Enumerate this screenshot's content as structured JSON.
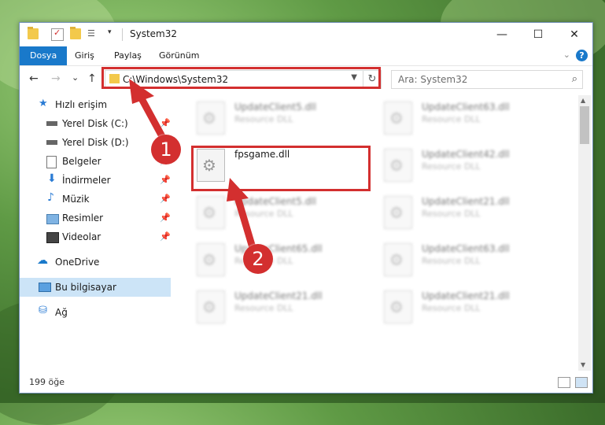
{
  "window": {
    "title": "System32",
    "tabs": [
      {
        "label": "Dosya"
      },
      {
        "label": "Giriş"
      },
      {
        "label": "Paylaş"
      },
      {
        "label": "Görünüm"
      }
    ],
    "controls": {
      "minimize": "—",
      "maximize": "☐",
      "close": "✕"
    }
  },
  "nav": {
    "back": "←",
    "forward": "→",
    "recent": "⌄",
    "up": "↑",
    "address": "C:\\Windows\\System32",
    "refresh": "↻",
    "search_placeholder": "Ara: System32"
  },
  "sidebar": {
    "items": [
      {
        "label": "Hızlı erişim",
        "icon": "star-icon",
        "color": "#2a7bd4"
      },
      {
        "label": "Yerel Disk (C:)",
        "icon": "drive-icon",
        "pinned": true
      },
      {
        "label": "Yerel Disk (D:)",
        "icon": "drive-icon",
        "pinned": true
      },
      {
        "label": "Belgeler",
        "icon": "documents-icon",
        "pinned": true
      },
      {
        "label": "İndirmeler",
        "icon": "download-icon",
        "pinned": true
      },
      {
        "label": "Müzik",
        "icon": "music-icon",
        "pinned": true
      },
      {
        "label": "Resimler",
        "icon": "pictures-icon",
        "pinned": true
      },
      {
        "label": "Videolar",
        "icon": "videos-icon",
        "pinned": true
      },
      {
        "label": "OneDrive",
        "icon": "cloud-icon"
      },
      {
        "label": "Bu bilgisayar",
        "icon": "computer-icon",
        "selected": true
      },
      {
        "label": "Ağ",
        "icon": "network-icon"
      }
    ]
  },
  "files": {
    "highlighted": {
      "name": "fpsgame.dll",
      "description": ""
    },
    "left_column": [
      {
        "name": "UpdateClient5.dll",
        "description": "Resource DLL"
      },
      {
        "name": "UpdateClient5.dll",
        "description": "Resource DLL"
      },
      {
        "name": "UpdateClient65.dll",
        "description": "Resource DLL"
      },
      {
        "name": "UpdateClient21.dll",
        "description": "Resource DLL"
      }
    ],
    "right_column": [
      {
        "name": "UpdateClient63.dll",
        "description": "Resource DLL"
      },
      {
        "name": "UpdateClient42.dll",
        "description": "Resource DLL"
      },
      {
        "name": "UpdateClient21.dll",
        "description": "Resource DLL"
      },
      {
        "name": "UpdateClient63.dll",
        "description": "Resource DLL"
      },
      {
        "name": "UpdateClient21.dll",
        "description": "Resource DLL"
      }
    ]
  },
  "status": {
    "item_count": "199 öğe"
  },
  "annotations": {
    "step1": "1",
    "step2": "2",
    "color": "#d32f2f"
  }
}
